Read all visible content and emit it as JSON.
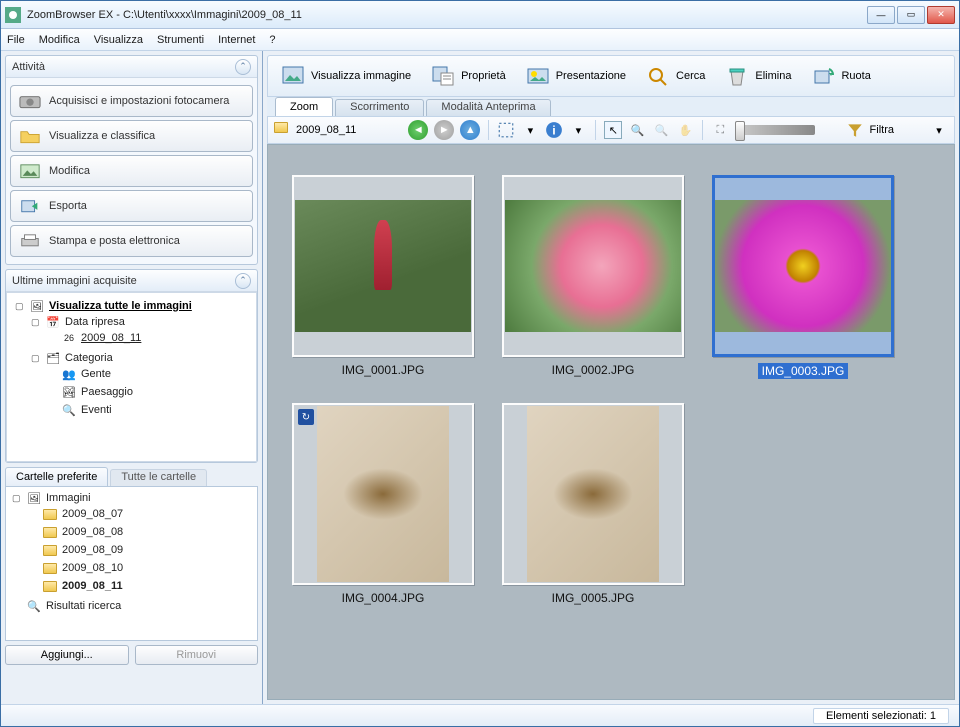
{
  "window": {
    "title": "ZoomBrowser EX - C:\\Utenti\\xxxx\\Immagini\\2009_08_11"
  },
  "menu": {
    "file": "File",
    "edit": "Modifica",
    "view": "Visualizza",
    "tools": "Strumenti",
    "internet": "Internet",
    "help": "?"
  },
  "activity": {
    "header": "Attività",
    "acquire": "Acquisisci e impostazioni fotocamera",
    "classify": "Visualizza e classifica",
    "modify": "Modifica",
    "export": "Esporta",
    "print": "Stampa e posta elettronica"
  },
  "latest": {
    "header": "Ultime immagini acquisite",
    "all": "Visualizza tutte le immagini",
    "date_taken": "Data ripresa",
    "date_val": "2009_08_11",
    "category": "Categoria",
    "people": "Gente",
    "landscape": "Paesaggio",
    "events": "Eventi"
  },
  "favorites": {
    "tab_fav": "Cartelle preferite",
    "tab_all": "Tutte le cartelle",
    "root": "Immagini",
    "folders": [
      "2009_08_07",
      "2009_08_08",
      "2009_08_09",
      "2009_08_10",
      "2009_08_11"
    ],
    "search_results": "Risultati ricerca",
    "add": "Aggiungi...",
    "remove": "Rimuovi"
  },
  "toolbar": {
    "view_img": "Visualizza immagine",
    "props": "Proprietà",
    "slideshow": "Presentazione",
    "search": "Cerca",
    "delete": "Elimina",
    "rotate": "Ruota"
  },
  "viewtabs": {
    "zoom": "Zoom",
    "scroll": "Scorrimento",
    "preview": "Modalità Anteprima"
  },
  "browserbar": {
    "crumb": "2009_08_11",
    "filter": "Filtra"
  },
  "thumbs": [
    {
      "label": "IMG_0001.JPG",
      "selected": false,
      "portrait": false,
      "cls": "img1",
      "rotated": false
    },
    {
      "label": "IMG_0002.JPG",
      "selected": false,
      "portrait": false,
      "cls": "img2",
      "rotated": false
    },
    {
      "label": "IMG_0003.JPG",
      "selected": true,
      "portrait": false,
      "cls": "img3",
      "rotated": false
    },
    {
      "label": "IMG_0004.JPG",
      "selected": false,
      "portrait": true,
      "cls": "img4",
      "rotated": true
    },
    {
      "label": "IMG_0005.JPG",
      "selected": false,
      "portrait": true,
      "cls": "img5",
      "rotated": false
    }
  ],
  "status": {
    "selected": "Elementi selezionati: 1"
  }
}
